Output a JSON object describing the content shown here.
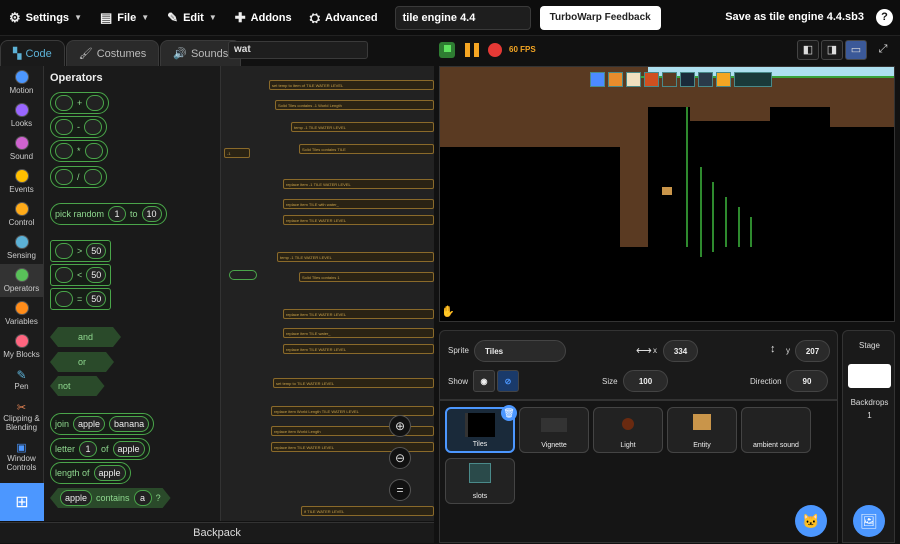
{
  "menu": {
    "settings": "Settings",
    "file": "File",
    "edit": "Edit",
    "addons": "Addons",
    "advanced": "Advanced",
    "project_title": "tile engine 4.4",
    "feedback": "TurboWarp Feedback",
    "save_as": "Save as tile engine 4.4.sb3",
    "help": "?"
  },
  "tabs": {
    "code": "Code",
    "costumes": "Costumes",
    "sounds": "Sounds"
  },
  "workspace_search": "wat",
  "categories": [
    "Motion",
    "Looks",
    "Sound",
    "Events",
    "Control",
    "Sensing",
    "Operators",
    "Variables",
    "My Blocks",
    "Pen",
    "Clipping & Blending",
    "Window Controls"
  ],
  "category_colors": [
    "#4c97ff",
    "#9966ff",
    "#cf63cf",
    "#ffbf00",
    "#ffab19",
    "#5cb1d6",
    "#59c059",
    "#ff8c1a",
    "#ff6680",
    "#0fbd8c",
    "#0fbd8c",
    "#4c97ff"
  ],
  "palette": {
    "heading": "Operators",
    "ops": [
      "+",
      "-",
      "*",
      "/"
    ],
    "pick_random": "pick random",
    "pick_a": "1",
    "pick_to": "to",
    "pick_b": "10",
    "cmp": [
      ">",
      "<",
      "="
    ],
    "cmp_val": "50",
    "and": "and",
    "or": "or",
    "not": "not",
    "join": "join",
    "join_a": "apple",
    "join_b": "banana",
    "letter": "letter",
    "letter_n": "1",
    "letter_of": "of",
    "letter_s": "apple",
    "length_of": "length of",
    "length_s": "apple",
    "contains_s": "apple",
    "contains": "contains",
    "contains_c": "a",
    "contains_q": "?"
  },
  "script_texts": {
    "tile_water_level": "TILE WATER LEVEL",
    "world_length": "World Length",
    "solid_tiles": "Solid Tiles",
    "contains": "contains",
    "replace_item": "replace item",
    "temp": "temp",
    "tile": "TILE",
    "water": "water_",
    "minus_one": "-1",
    "one": "1",
    "else": "else",
    "if": "if",
    "set": "set",
    "to": "to",
    "with": "with",
    "of": "of",
    "item": "item",
    "side_value": "-1"
  },
  "backpack": "Backpack",
  "stage_controls": {
    "fps": "60 FPS"
  },
  "sprite_info": {
    "sprite_label": "Sprite",
    "sprite_name": "Tiles",
    "x_label": "x",
    "x": "334",
    "y_label": "y",
    "y": "207",
    "show_label": "Show",
    "size_label": "Size",
    "size": "100",
    "direction_label": "Direction",
    "direction": "90"
  },
  "sprites": [
    "Tiles",
    "Vignette",
    "Light",
    "Entity",
    "ambient sound",
    "slots"
  ],
  "stage_pane": {
    "title": "Stage",
    "backdrops_label": "Backdrops",
    "backdrops_count": "1"
  }
}
